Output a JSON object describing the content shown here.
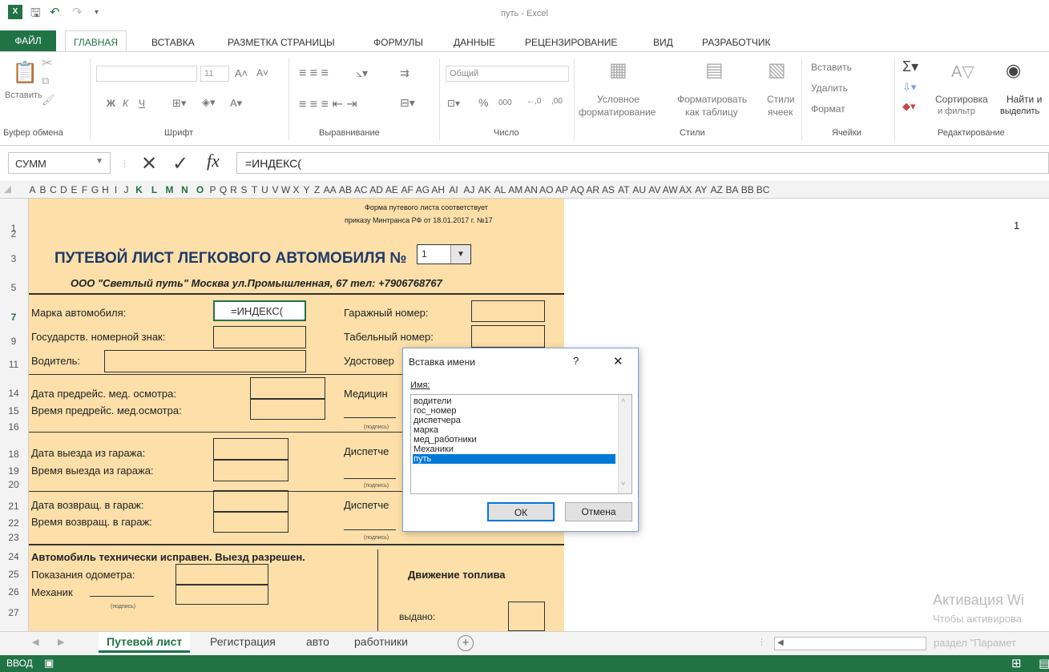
{
  "window": {
    "title": "путь - Excel"
  },
  "ribbon_tabs": [
    "ФАЙЛ",
    "ГЛАВНАЯ",
    "ВСТАВКА",
    "РАЗМЕТКА СТРАНИЦЫ",
    "ФОРМУЛЫ",
    "ДАННЫЕ",
    "РЕЦЕНЗИРОВАНИЕ",
    "ВИД",
    "РАЗРАБОТЧИК"
  ],
  "ribbon": {
    "paste": "Вставить",
    "font_size": "11",
    "bold": "Ж",
    "italic": "К",
    "underline": "Ч",
    "number_format": "Общий",
    "percent": "%",
    "thousands": "000",
    "inc_decimal": "←,0",
    "dec_decimal": ",00",
    "cond_format": "Условное",
    "cond_format2": "форматирование",
    "format_table": "Форматировать",
    "format_table2": "как таблицу",
    "cell_styles": "Стили",
    "cell_styles2": "ячеек",
    "insert_cells": "Вставить",
    "delete_cells": "Удалить",
    "format_cells": "Формат",
    "sort": "Сортировка",
    "sort2": "и фильтр",
    "find": "Найти и",
    "find2": "выделить",
    "groups": {
      "clipboard": "Буфер обмена",
      "font": "Шрифт",
      "align": "Выравнивание",
      "number": "Число",
      "styles": "Стили",
      "cells": "Ячейки",
      "edit": "Редактирование"
    }
  },
  "formula_bar": {
    "name_box": "СУММ",
    "formula": "=ИНДЕКС(",
    "fx": "fx"
  },
  "columns": [
    "A",
    "B",
    "C",
    "D",
    "E",
    "F",
    "G",
    "H",
    "I",
    "J",
    "K",
    "L",
    "M",
    "N",
    "O",
    "P",
    "Q",
    "R",
    "S",
    "T",
    "U",
    "V",
    "W",
    "X",
    "Y",
    "Z",
    "AA",
    "AB",
    "AC",
    "AD",
    "AE",
    "AF",
    "AG",
    "AH",
    "AI",
    "AJ",
    "AK",
    "AL",
    "AM",
    "AN",
    "AO",
    "AP",
    "AQ",
    "AR",
    "AS",
    "AT",
    "AU",
    "AV",
    "AW",
    "AX",
    "AY",
    "AZ",
    "BA",
    "BB",
    "BC"
  ],
  "selected_columns": [
    "K",
    "L",
    "M",
    "N",
    "O"
  ],
  "rows": [
    "1",
    "2",
    "3",
    "5",
    "7",
    "9",
    "11",
    "14",
    "15",
    "16",
    "18",
    "19",
    "20",
    "21",
    "22",
    "23",
    "24",
    "25",
    "26",
    "27"
  ],
  "sheet": {
    "form_note1": "Форма путевого листа соответствует",
    "form_note2": "приказу Минтранса РФ от 18.01.2017 г. №17",
    "title": "ПУТЕВОЙ ЛИСТ ЛЕГКОВОГО АВТОМОБИЛЯ №",
    "number": "1",
    "org": "ООО \"Светлый путь\" Москва ул.Промышленная, 67  тел: +7906768767",
    "car_brand": "Марка автомобиля:",
    "garage_no": "Гаражный номер:",
    "plate": "Государств. номерной знак:",
    "tab_no": "Табельный номер:",
    "driver": "Водитель:",
    "license": "Удостовер",
    "med_date": "Дата предрейс. мед. осмотра:",
    "med_worker": "Медицин",
    "med_time": "Время предрейс. мед.осмотра:",
    "sign": "(подпись)",
    "exit_date": "Дата выезда из гаража:",
    "dispatcher": "Диспетче",
    "exit_time": "Время выезда из гаража:",
    "ret_date": "Дата возвращ. в гараж:",
    "ret_time": "Время возвращ. в гараж:",
    "tech_ok": "Автомобиль технически исправен. Выезд разрешен.",
    "odometer": "Показания одометра:",
    "mechanic": "Механик",
    "fuel": "Движение топлива",
    "issued": "выдано:",
    "page_num": "1"
  },
  "dialog": {
    "title": "Вставка имени",
    "help": "?",
    "close": "✕",
    "name_label": "Имя:",
    "items": [
      "водители",
      "гос_номер",
      "диспетчера",
      "марка",
      "мед_работники",
      "Механики",
      "путь"
    ],
    "selected": "путь",
    "ok": "ОК",
    "cancel": "Отмена"
  },
  "sheet_tabs": [
    "Путевой лист",
    "Регистрация",
    "авто",
    "работники"
  ],
  "active_sheet": "Путевой лист",
  "status": {
    "mode": "ВВОД"
  },
  "watermark": {
    "line1": "Активация Wi",
    "line2": "Чтобы активирова",
    "line3": "раздел \"Парамет"
  },
  "colors": {
    "excel_green": "#217346",
    "sheet_fill": "#fcdfa9",
    "selection_blue": "#0078d7"
  }
}
